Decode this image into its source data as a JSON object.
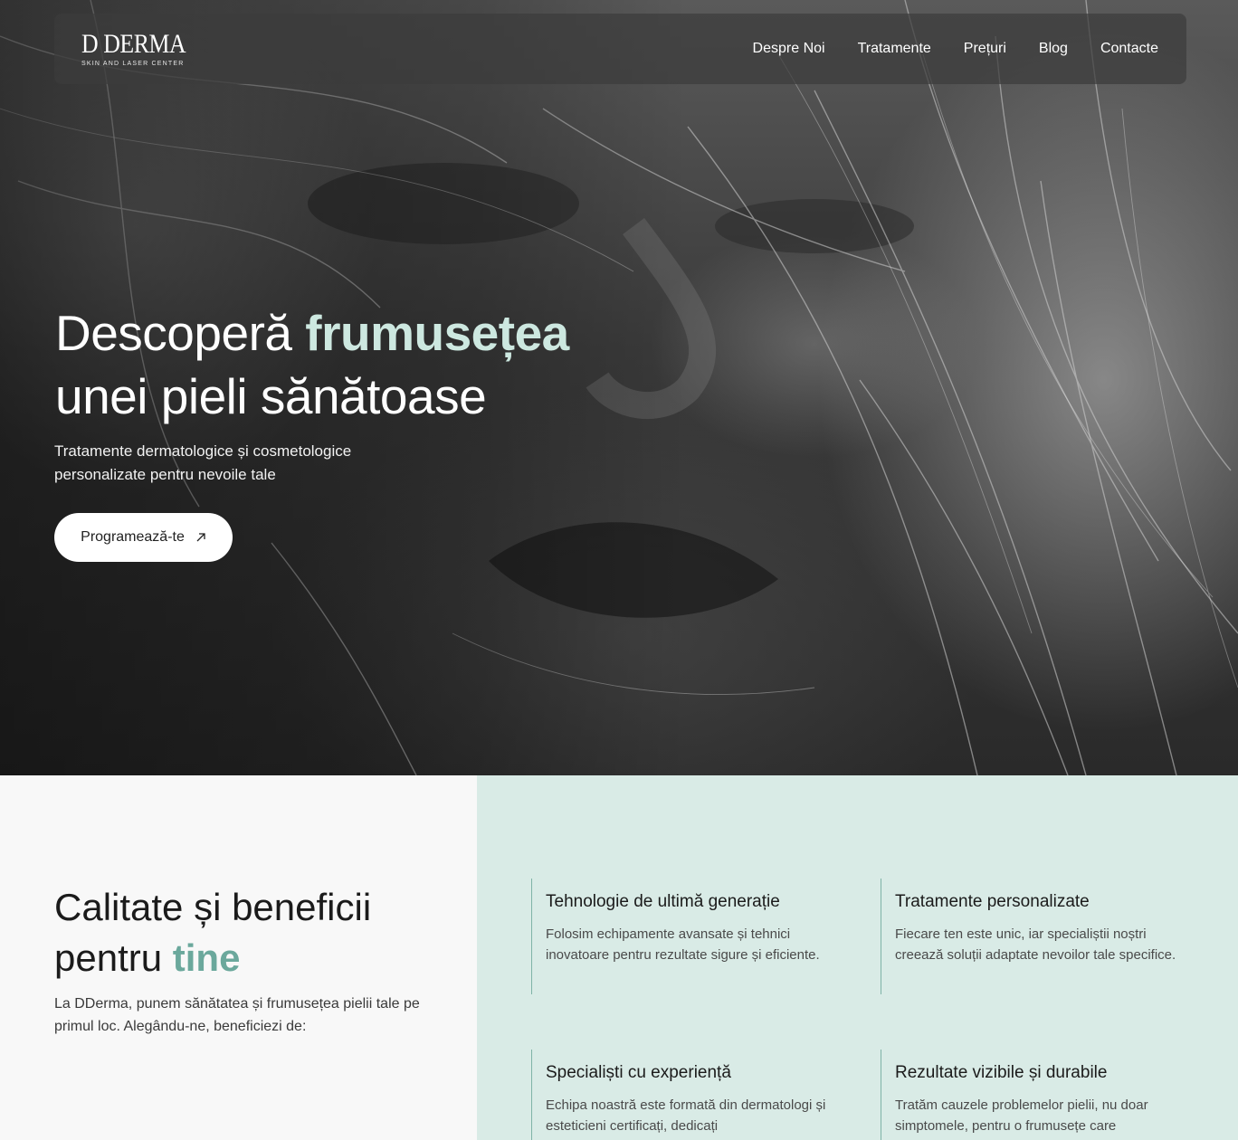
{
  "brand": {
    "name": "D DERMA",
    "tagline": "SKIN AND LASER CENTER"
  },
  "nav": {
    "items": [
      {
        "label": "Despre Noi"
      },
      {
        "label": "Tratamente"
      },
      {
        "label": "Prețuri"
      },
      {
        "label": "Blog"
      },
      {
        "label": "Contacte"
      }
    ]
  },
  "hero": {
    "title_start": "Descoperă ",
    "title_accent": "frumusețea",
    "title_end": "unei pieli sănătoase",
    "subtitle_line1": "Tratamente dermatologice și cosmetologice",
    "subtitle_line2": "personalizate pentru nevoile tale",
    "cta_label": "Programează-te",
    "accent_color": "#cde8e0"
  },
  "benefits": {
    "title_line1": "Calitate și beneficii",
    "title_line2_start": "pentru ",
    "title_accent": "tine",
    "intro": "La DDerma, punem sănătatea și frumusețea pielii tale pe primul loc. Alegându-ne, beneficiezi de:",
    "accent_color": "#6ba89c",
    "panel_color": "#d9ebe6",
    "cards": [
      {
        "title": "Tehnologie de ultimă generație",
        "text": "Folosim echipamente avansate și tehnici inovatoare pentru rezultate sigure și eficiente."
      },
      {
        "title": "Tratamente personalizate",
        "text": "Fiecare ten este unic, iar specialiștii noștri creează soluții adaptate nevoilor tale specifice."
      },
      {
        "title": "Specialiști cu experiență",
        "text": "Echipa noastră este formată din dermatologi și esteticieni certificați, dedicați"
      },
      {
        "title": "Rezultate vizibile și durabile",
        "text": "Tratăm cauzele problemelor pielii, nu doar simptomele, pentru o frumusețe care"
      }
    ]
  }
}
